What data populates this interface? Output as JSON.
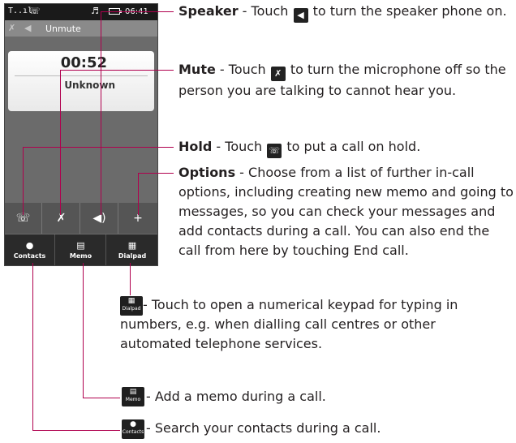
{
  "phone": {
    "status": {
      "signal": "T..ıl",
      "time": "06:41"
    },
    "callbar": {
      "label": "Unmute"
    },
    "call": {
      "timer": "00:52",
      "caller": "Unknown"
    },
    "buttons": {
      "hold_icon": "hold-icon",
      "mute_icon": "mute-icon",
      "speaker_icon": "speaker-icon",
      "plus": "+"
    },
    "tabs": [
      {
        "label": "Contacts",
        "icon": "contacts-icon"
      },
      {
        "label": "Memo",
        "icon": "memo-icon"
      },
      {
        "label": "Dialpad",
        "icon": "dialpad-icon"
      }
    ]
  },
  "speaker": {
    "title": "Speaker",
    "pre": " - Touch ",
    "post": " to turn the speaker phone on."
  },
  "mute": {
    "title": "Mute",
    "pre": " - Touch ",
    "post": " to turn the microphone off so the person you are talking to cannot hear you."
  },
  "hold": {
    "title": "Hold",
    "pre": " - Touch ",
    "post": " to put a call on hold."
  },
  "options": {
    "title": "Options",
    "text": " - Choose from a list of further in-call options, including creating new memo and going to messages, so you can check your messages and add contacts during a call. You can also end the call from here by touching End call."
  },
  "dialpad": {
    "icon_label": "Dialpad",
    "text": " - Touch to open a numerical keypad for typing in numbers, e.g. when dialling call centres or other automated telephone services."
  },
  "memo": {
    "icon_label": "Memo",
    "text": " - Add a memo during a call."
  },
  "contacts": {
    "icon_label": "Contacts",
    "text": " - Search your contacts during a call."
  },
  "colors": {
    "callout_line": "#b0004e",
    "phone_bg": "#6b6b6b"
  }
}
